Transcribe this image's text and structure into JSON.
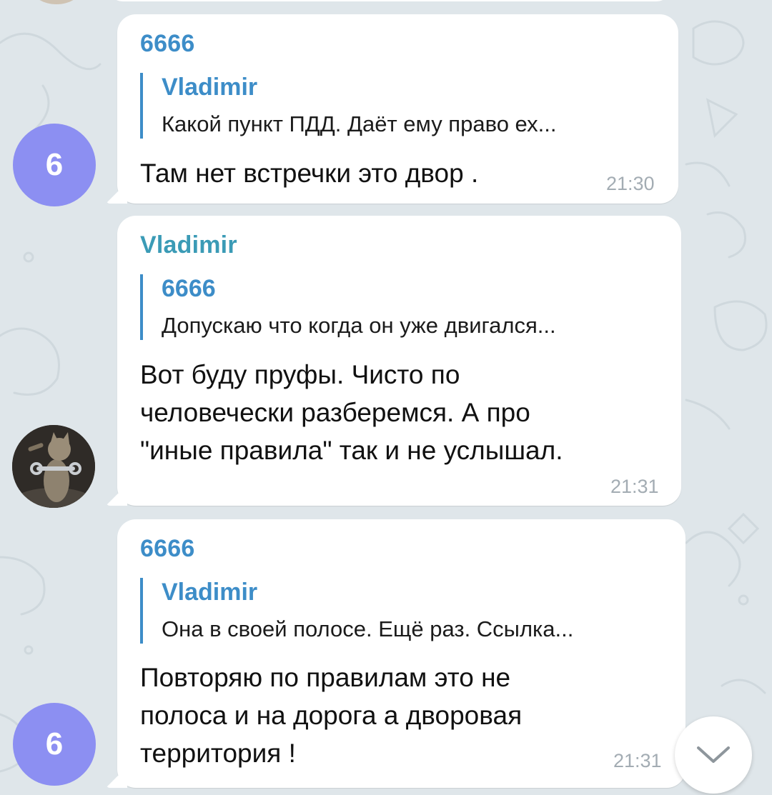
{
  "messages": [
    {
      "avatar_letter": "6",
      "sender": "6666",
      "reply_author": "Vladimir",
      "reply_text": "Какой пункт ПДД. Даёт ему право ех...",
      "text_lines": [
        "Там нет встречки это двор ."
      ],
      "time": "21:30"
    },
    {
      "avatar_letter": "",
      "sender": "Vladimir",
      "reply_author": "6666",
      "reply_text": "Допускаю что когда он уже двигался...",
      "text_lines": [
        "Вот буду пруфы. Чисто по",
        "человечески разберемся. А про",
        "\"иные правила\" так и не услышал."
      ],
      "time": "21:31"
    },
    {
      "avatar_letter": "6",
      "sender": "6666",
      "reply_author": "Vladimir",
      "reply_text": "Она в своей полосе. Ещё раз. Ссылка...",
      "text_lines": [
        "Повторяю по правилам это не",
        "полоса и на дорога а дворовая",
        "территория !"
      ],
      "time": "21:31"
    }
  ],
  "icons": {
    "scroll_down": "chevron-down-icon",
    "avatar_photo": "cat-with-wrench-avatar"
  },
  "colors": {
    "background": "#dfe6ea",
    "bubble": "#ffffff",
    "name_blue": "#3d8dc8",
    "name_teal": "#3b9bb6",
    "avatar_purple": "#8c8ff2",
    "time_gray": "#a3acb3"
  }
}
